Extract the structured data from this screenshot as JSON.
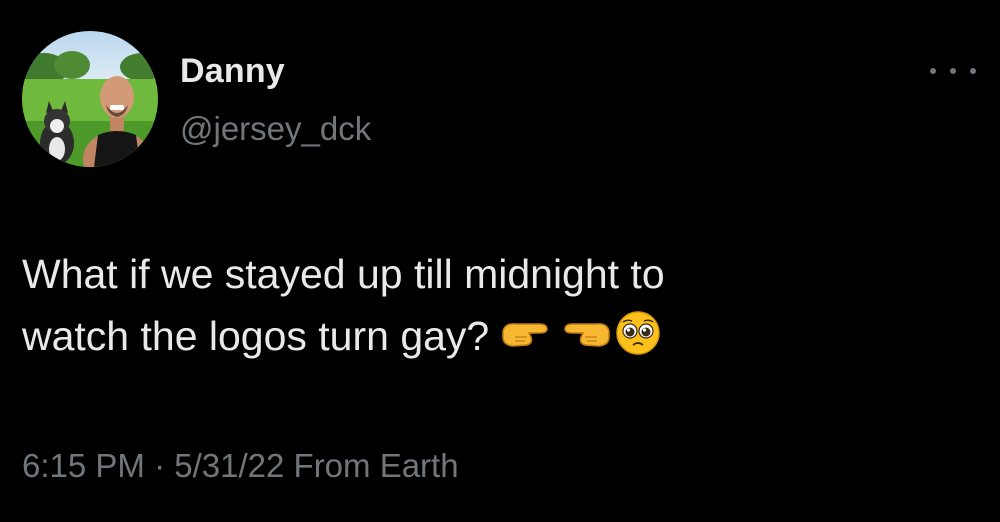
{
  "author": {
    "display_name": "Danny",
    "handle": "@jersey_dck"
  },
  "tweet": {
    "line1": "What if we stayed up till midnight to",
    "line2": "watch the logos turn gay?",
    "emojis": [
      "backhand-index-pointing-right-icon",
      "backhand-index-pointing-left-icon",
      "pleading-face-icon"
    ]
  },
  "meta": {
    "time": "6:15 PM",
    "separator": "·",
    "date": "5/31/22",
    "source": "From Earth"
  },
  "colors": {
    "background": "#000000",
    "primary_text": "#e7e9ea",
    "secondary_text": "#71767b",
    "emoji_yellow": "#f7b733"
  },
  "icons": {
    "more": "more-options-icon"
  }
}
